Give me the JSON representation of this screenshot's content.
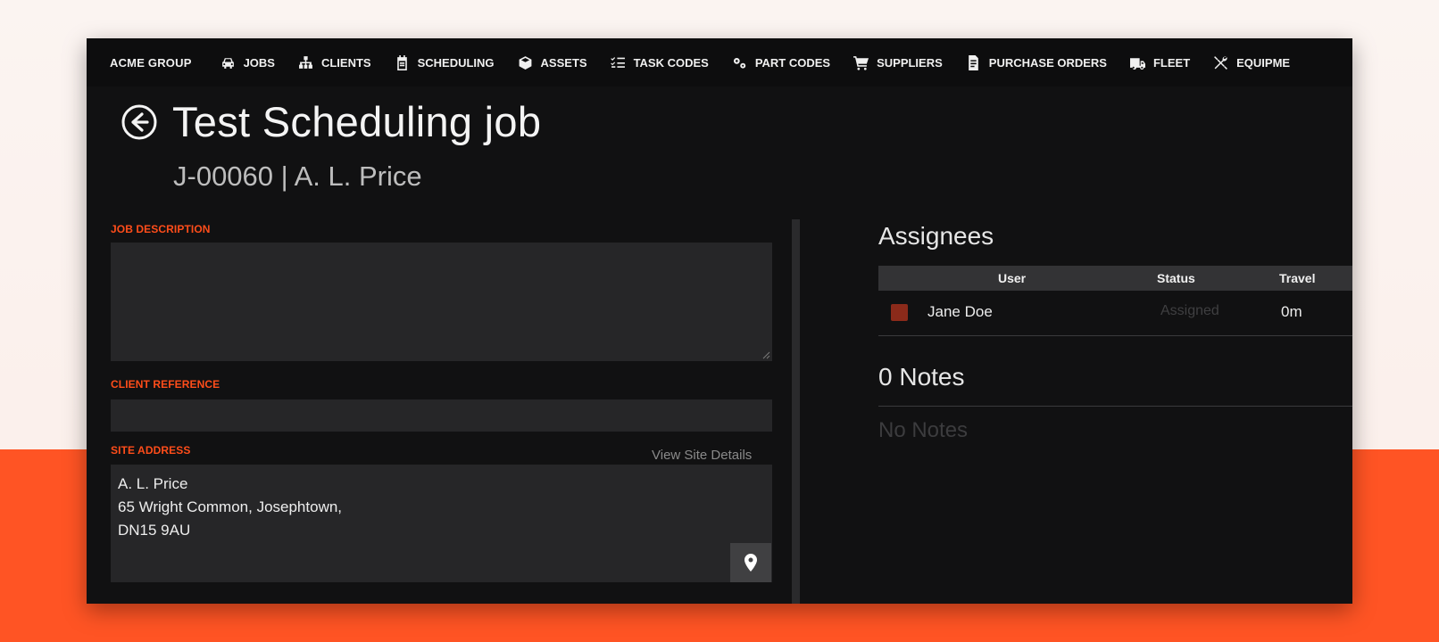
{
  "nav": {
    "brand": "ACME GROUP",
    "items": [
      {
        "label": "JOBS",
        "icon": "car-icon"
      },
      {
        "label": "CLIENTS",
        "icon": "sitemap-icon"
      },
      {
        "label": "SCHEDULING",
        "icon": "calendar-icon"
      },
      {
        "label": "ASSETS",
        "icon": "cube-icon"
      },
      {
        "label": "TASK CODES",
        "icon": "checklist-icon"
      },
      {
        "label": "PART CODES",
        "icon": "gears-icon"
      },
      {
        "label": "SUPPLIERS",
        "icon": "cart-icon"
      },
      {
        "label": "PURCHASE ORDERS",
        "icon": "document-icon"
      },
      {
        "label": "FLEET",
        "icon": "truck-icon"
      },
      {
        "label": "EQUIPME",
        "icon": "tools-icon"
      }
    ]
  },
  "header": {
    "title": "Test Scheduling job",
    "subtitle": "J-00060 | A. L. Price"
  },
  "form": {
    "job_description_label": "JOB DESCRIPTION",
    "job_description_value": "",
    "client_reference_label": "CLIENT REFERENCE",
    "client_reference_value": "",
    "site_address_label": "SITE ADDRESS",
    "view_site_details": "View Site Details",
    "site_address_lines": [
      "A. L. Price",
      "65 Wright Common, Josephtown,",
      "DN15 9AU"
    ]
  },
  "assignees": {
    "title": "Assignees",
    "columns": [
      "User",
      "Status",
      "Travel"
    ],
    "rows": [
      {
        "user": "Jane Doe",
        "status": "Assigned",
        "travel": "0m",
        "color": "#8b2a1a"
      }
    ]
  },
  "notes": {
    "title": "0 Notes",
    "empty": "No Notes"
  },
  "colors": {
    "accent": "#ff4d1a",
    "background_orange": "#ff5424",
    "app_background": "#111112"
  }
}
